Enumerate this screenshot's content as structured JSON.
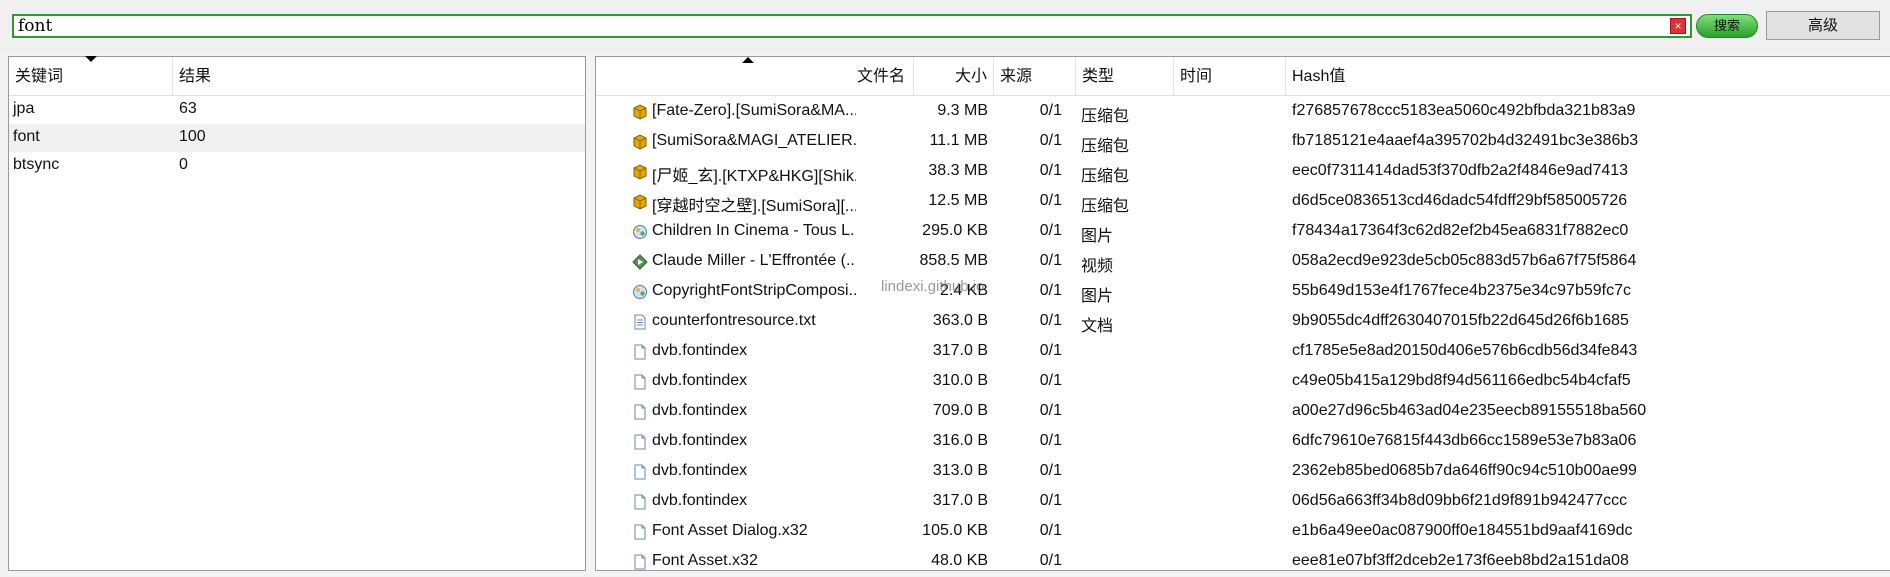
{
  "search": {
    "query": "font",
    "button_label": "搜索",
    "advanced_label": "高级"
  },
  "keywords": {
    "headers": {
      "keyword": "关键词",
      "result": "结果"
    },
    "rows": [
      {
        "keyword": "jpa",
        "result": "63"
      },
      {
        "keyword": "font",
        "result": "100"
      },
      {
        "keyword": "btsync",
        "result": "0"
      }
    ]
  },
  "files": {
    "headers": {
      "name": "文件名",
      "size": "大小",
      "source": "来源",
      "type": "类型",
      "time": "时间",
      "hash": "Hash值"
    },
    "rows": [
      {
        "icon": "archive-icon",
        "name": "[Fate-Zero].[SumiSora&MA...",
        "size": "9.3 MB",
        "source": "0/1",
        "type": "压缩包",
        "hash": "f276857678ccc5183ea5060c492bfbda321b83a9"
      },
      {
        "icon": "archive-icon",
        "name": "[SumiSora&MAGI_ATELIER...",
        "size": "11.1 MB",
        "source": "0/1",
        "type": "压缩包",
        "hash": "fb7185121e4aaef4a395702b4d32491bc3e386b3"
      },
      {
        "icon": "archive-icon",
        "name": "[尸姬_玄].[KTXP&HKG][Shik...",
        "size": "38.3 MB",
        "source": "0/1",
        "type": "压缩包",
        "hash": "eec0f7311414dad53f370dfb2a2f4846e9ad7413"
      },
      {
        "icon": "archive-icon",
        "name": "[穿越时空之壁].[SumiSora][...",
        "size": "12.5 MB",
        "source": "0/1",
        "type": "压缩包",
        "hash": "d6d5ce0836513cd46dadc54fdff29bf585005726"
      },
      {
        "icon": "image-icon",
        "name": "Children In Cinema - Tous L...",
        "size": "295.0 KB",
        "source": "0/1",
        "type": "图片",
        "hash": "f78434a17364f3c62d82ef2b45ea6831f7882ec0"
      },
      {
        "icon": "video-icon",
        "name": "Claude Miller - L'Effrontée (...",
        "size": "858.5 MB",
        "source": "0/1",
        "type": "视频",
        "hash": "058a2ecd9e923de5cb05c883d57b6a67f75f5864"
      },
      {
        "icon": "image-icon",
        "name": "CopyrightFontStripComposi...",
        "size": "2.4 KB",
        "source": "0/1",
        "type": "图片",
        "hash": "55b649d153e4f1767fece4b2375e34c97b59fc7c"
      },
      {
        "icon": "text-file-icon",
        "name": "counterfontresource.txt",
        "size": "363.0 B",
        "source": "0/1",
        "type": "文档",
        "hash": "9b9055dc4dff2630407015fb22d645d26f6b1685"
      },
      {
        "icon": "file-icon",
        "name": "dvb.fontindex",
        "size": "317.0 B",
        "source": "0/1",
        "type": "",
        "hash": "cf1785e5e8ad20150d406e576b6cdb56d34fe843"
      },
      {
        "icon": "file-icon",
        "name": "dvb.fontindex",
        "size": "310.0 B",
        "source": "0/1",
        "type": "",
        "hash": "c49e05b415a129bd8f94d561166edbc54b4cfaf5"
      },
      {
        "icon": "file-icon",
        "name": "dvb.fontindex",
        "size": "709.0 B",
        "source": "0/1",
        "type": "",
        "hash": "a00e27d96c5b463ad04e235eecb89155518ba560"
      },
      {
        "icon": "file-icon",
        "name": "dvb.fontindex",
        "size": "316.0 B",
        "source": "0/1",
        "type": "",
        "hash": "6dfc79610e76815f443db66cc1589e53e7b83a06"
      },
      {
        "icon": "file-icon",
        "name": "dvb.fontindex",
        "size": "313.0 B",
        "source": "0/1",
        "type": "",
        "hash": "2362eb85bed0685b7da646ff90c94c510b00ae99"
      },
      {
        "icon": "file-icon",
        "name": "dvb.fontindex",
        "size": "317.0 B",
        "source": "0/1",
        "type": "",
        "hash": "06d56a663ff34b8d09bb6f21d9f891b942477ccc"
      },
      {
        "icon": "file-icon",
        "name": "Font Asset Dialog.x32",
        "size": "105.0 KB",
        "source": "0/1",
        "type": "",
        "hash": "e1b6a49ee0ac087900ff0e184551bd9aaf4169dc"
      },
      {
        "icon": "file-icon",
        "name": "Font Asset.x32",
        "size": "48.0 KB",
        "source": "0/1",
        "type": "",
        "hash": "eee81e07bf3ff2dceb2e173f6eeb8bd2a151da08"
      }
    ]
  },
  "watermark": "lindexi.github.io",
  "colors": {
    "search_border": "#2e9a2e",
    "search_button": "#4cc04a",
    "clear_icon": "#d33333"
  }
}
